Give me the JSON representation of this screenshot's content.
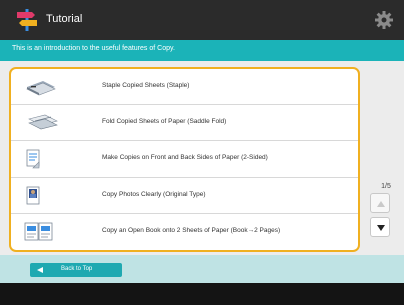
{
  "header": {
    "title": "Tutorial",
    "app_icon": "signpost-icon",
    "settings_icon": "gear-icon"
  },
  "banner": {
    "text": "This is an introduction to the useful features of Copy."
  },
  "features": [
    {
      "label": "Staple Copied Sheets (Staple)",
      "icon": "staple-icon"
    },
    {
      "label": "Fold Copied Sheets of Paper (Saddle Fold)",
      "icon": "saddle-fold-icon"
    },
    {
      "label": "Make Copies on Front and Back Sides of Paper (2-Sided)",
      "icon": "two-sided-icon"
    },
    {
      "label": "Copy Photos Clearly (Original Type)",
      "icon": "photo-original-icon"
    },
    {
      "label": "Copy an Open Book onto 2 Sheets of Paper (Book→2 Pages)",
      "icon": "book-two-pages-icon"
    }
  ],
  "pagination": {
    "indicator": "1/5"
  },
  "footer": {
    "back_label": "Back to Top"
  },
  "colors": {
    "accent": "#1bb3b8",
    "selection_border": "#f0b020",
    "titlebar": "#2b2b2b"
  }
}
